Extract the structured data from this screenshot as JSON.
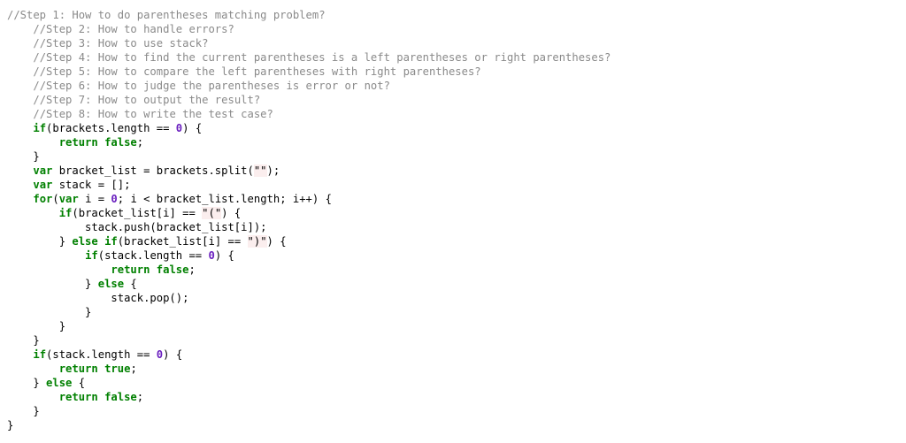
{
  "colors": {
    "comment": "#8a8a8a",
    "keyword": "#008000",
    "number": "#6a1fbf",
    "string_background": "#fbeeee",
    "text": "#000000"
  },
  "code": {
    "lines": [
      [
        {
          "t": "c",
          "v": "//Step 1: How to do parentheses matching problem?"
        }
      ],
      [
        {
          "t": "p",
          "v": "    "
        },
        {
          "t": "c",
          "v": "//Step 2: How to handle errors?"
        }
      ],
      [
        {
          "t": "p",
          "v": "    "
        },
        {
          "t": "c",
          "v": "//Step 3: How to use stack?"
        }
      ],
      [
        {
          "t": "p",
          "v": "    "
        },
        {
          "t": "c",
          "v": "//Step 4: How to find the current parentheses is a left parentheses or right parentheses?"
        }
      ],
      [
        {
          "t": "p",
          "v": "    "
        },
        {
          "t": "c",
          "v": "//Step 5: How to compare the left parentheses with right parentheses?"
        }
      ],
      [
        {
          "t": "p",
          "v": "    "
        },
        {
          "t": "c",
          "v": "//Step 6: How to judge the parentheses is error or not?"
        }
      ],
      [
        {
          "t": "p",
          "v": "    "
        },
        {
          "t": "c",
          "v": "//Step 7: How to output the result?"
        }
      ],
      [
        {
          "t": "p",
          "v": "    "
        },
        {
          "t": "c",
          "v": "//Step 8: How to write the test case?"
        }
      ],
      [
        {
          "t": "p",
          "v": "    "
        },
        {
          "t": "k",
          "v": "if"
        },
        {
          "t": "p",
          "v": "(brackets.length == "
        },
        {
          "t": "n",
          "v": "0"
        },
        {
          "t": "p",
          "v": ") {"
        }
      ],
      [
        {
          "t": "p",
          "v": "        "
        },
        {
          "t": "k",
          "v": "return"
        },
        {
          "t": "p",
          "v": " "
        },
        {
          "t": "k",
          "v": "false"
        },
        {
          "t": "p",
          "v": ";"
        }
      ],
      [
        {
          "t": "p",
          "v": "    }"
        }
      ],
      [
        {
          "t": "p",
          "v": "    "
        },
        {
          "t": "k",
          "v": "var"
        },
        {
          "t": "p",
          "v": " bracket_list = brackets.split("
        },
        {
          "t": "s",
          "v": "\"\""
        },
        {
          "t": "p",
          "v": ");"
        }
      ],
      [
        {
          "t": "p",
          "v": "    "
        },
        {
          "t": "k",
          "v": "var"
        },
        {
          "t": "p",
          "v": " stack = [];"
        }
      ],
      [
        {
          "t": "p",
          "v": "    "
        },
        {
          "t": "k",
          "v": "for"
        },
        {
          "t": "p",
          "v": "("
        },
        {
          "t": "k",
          "v": "var"
        },
        {
          "t": "p",
          "v": " i = "
        },
        {
          "t": "n",
          "v": "0"
        },
        {
          "t": "p",
          "v": "; i < bracket_list.length; i++) {"
        }
      ],
      [
        {
          "t": "p",
          "v": "        "
        },
        {
          "t": "k",
          "v": "if"
        },
        {
          "t": "p",
          "v": "(bracket_list[i] == "
        },
        {
          "t": "s",
          "v": "\"(\""
        },
        {
          "t": "p",
          "v": ") {"
        }
      ],
      [
        {
          "t": "p",
          "v": "            stack.push(bracket_list[i]);"
        }
      ],
      [
        {
          "t": "p",
          "v": "        } "
        },
        {
          "t": "k",
          "v": "else"
        },
        {
          "t": "p",
          "v": " "
        },
        {
          "t": "k",
          "v": "if"
        },
        {
          "t": "p",
          "v": "(bracket_list[i] == "
        },
        {
          "t": "s",
          "v": "\")\""
        },
        {
          "t": "p",
          "v": ") {"
        }
      ],
      [
        {
          "t": "p",
          "v": "            "
        },
        {
          "t": "k",
          "v": "if"
        },
        {
          "t": "p",
          "v": "(stack.length == "
        },
        {
          "t": "n",
          "v": "0"
        },
        {
          "t": "p",
          "v": ") {"
        }
      ],
      [
        {
          "t": "p",
          "v": "                "
        },
        {
          "t": "k",
          "v": "return"
        },
        {
          "t": "p",
          "v": " "
        },
        {
          "t": "k",
          "v": "false"
        },
        {
          "t": "p",
          "v": ";"
        }
      ],
      [
        {
          "t": "p",
          "v": "            } "
        },
        {
          "t": "k",
          "v": "else"
        },
        {
          "t": "p",
          "v": " {"
        }
      ],
      [
        {
          "t": "p",
          "v": "                stack.pop();"
        }
      ],
      [
        {
          "t": "p",
          "v": "            }"
        }
      ],
      [
        {
          "t": "p",
          "v": "        }"
        }
      ],
      [
        {
          "t": "p",
          "v": "    }"
        }
      ],
      [
        {
          "t": "p",
          "v": "    "
        },
        {
          "t": "k",
          "v": "if"
        },
        {
          "t": "p",
          "v": "(stack.length == "
        },
        {
          "t": "n",
          "v": "0"
        },
        {
          "t": "p",
          "v": ") {"
        }
      ],
      [
        {
          "t": "p",
          "v": "        "
        },
        {
          "t": "k",
          "v": "return"
        },
        {
          "t": "p",
          "v": " "
        },
        {
          "t": "k",
          "v": "true"
        },
        {
          "t": "p",
          "v": ";"
        }
      ],
      [
        {
          "t": "p",
          "v": "    } "
        },
        {
          "t": "k",
          "v": "else"
        },
        {
          "t": "p",
          "v": " {"
        }
      ],
      [
        {
          "t": "p",
          "v": "        "
        },
        {
          "t": "k",
          "v": "return"
        },
        {
          "t": "p",
          "v": " "
        },
        {
          "t": "k",
          "v": "false"
        },
        {
          "t": "p",
          "v": ";"
        }
      ],
      [
        {
          "t": "p",
          "v": "    }"
        }
      ],
      [
        {
          "t": "p",
          "v": "}"
        }
      ]
    ]
  }
}
